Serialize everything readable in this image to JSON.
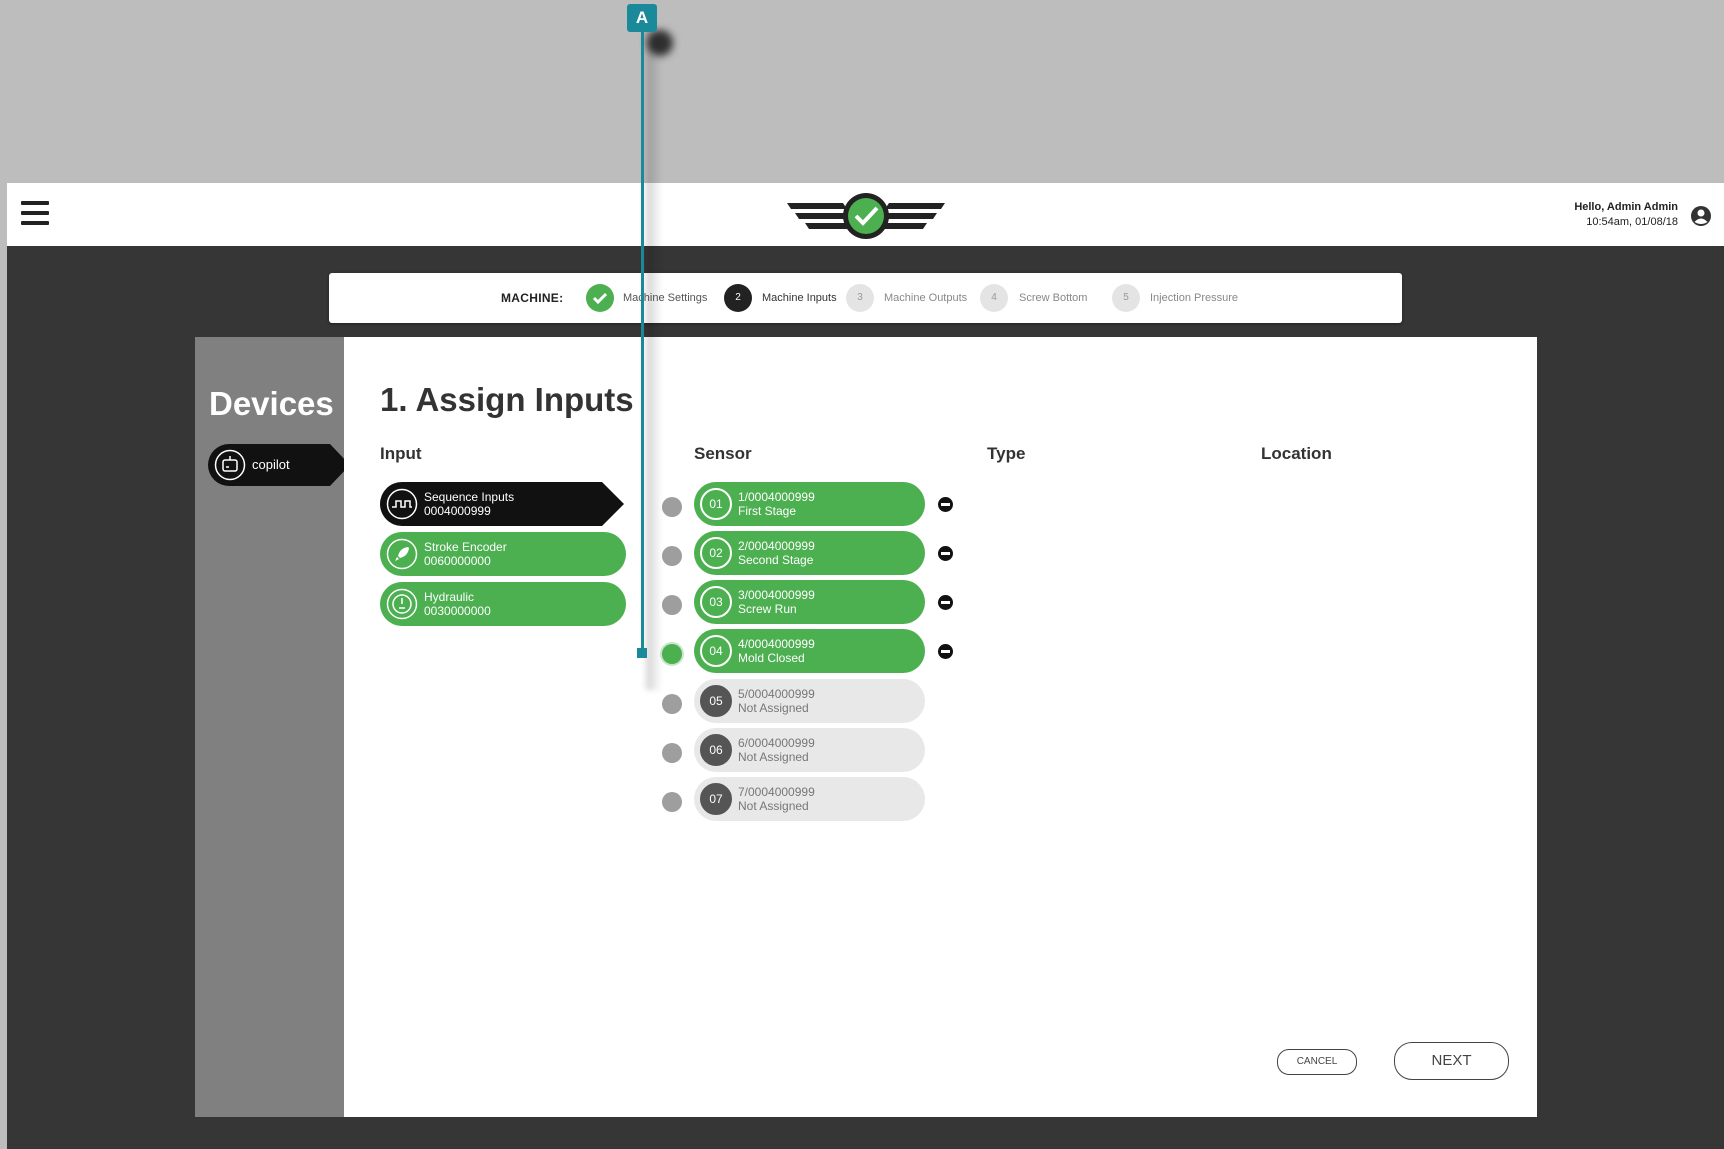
{
  "callout": {
    "label": "A"
  },
  "header": {
    "greeting": "Hello, Admin Admin",
    "timestamp": "10:54am, 01/08/18"
  },
  "stepper": {
    "label": "MACHINE:",
    "steps": [
      {
        "number": "",
        "label": "Machine Settings",
        "state": "done"
      },
      {
        "number": "2",
        "label": "Machine Inputs",
        "state": "active"
      },
      {
        "number": "3",
        "label": "Machine Outputs",
        "state": "todo"
      },
      {
        "number": "4",
        "label": "Screw Bottom",
        "state": "todo"
      },
      {
        "number": "5",
        "label": "Injection Pressure",
        "state": "todo"
      }
    ]
  },
  "devices": {
    "title": "Devices",
    "items": [
      {
        "label": "copilot"
      }
    ]
  },
  "main": {
    "title": "1. Assign Inputs",
    "columns": {
      "input": "Input",
      "sensor": "Sensor",
      "type": "Type",
      "location": "Location"
    },
    "inputs": [
      {
        "name": "Sequence Inputs",
        "id": "0004000999",
        "icon": "sequence-wave-icon",
        "active": true
      },
      {
        "name": "Stroke Encoder",
        "id": "0060000000",
        "icon": "rocket-icon",
        "active": false
      },
      {
        "name": "Hydraulic",
        "id": "0030000000",
        "icon": "gauge-icon",
        "active": false
      }
    ],
    "sensors": [
      {
        "num": "01",
        "code": "1/0004000999",
        "name": "First Stage",
        "assigned": true
      },
      {
        "num": "02",
        "code": "2/0004000999",
        "name": "Second Stage",
        "assigned": true
      },
      {
        "num": "03",
        "code": "3/0004000999",
        "name": "Screw Run",
        "assigned": true
      },
      {
        "num": "04",
        "code": "4/0004000999",
        "name": "Mold Closed",
        "assigned": true
      },
      {
        "num": "05",
        "code": "5/0004000999",
        "name": "Not Assigned",
        "assigned": false
      },
      {
        "num": "06",
        "code": "6/0004000999",
        "name": "Not Assigned",
        "assigned": false
      },
      {
        "num": "07",
        "code": "7/0004000999",
        "name": "Not Assigned",
        "assigned": false
      }
    ],
    "cancel_label": "CANCEL",
    "next_label": "NEXT"
  },
  "colors": {
    "accent": "#4caf50",
    "callout": "#1a8a9a",
    "dark": "#111111"
  }
}
